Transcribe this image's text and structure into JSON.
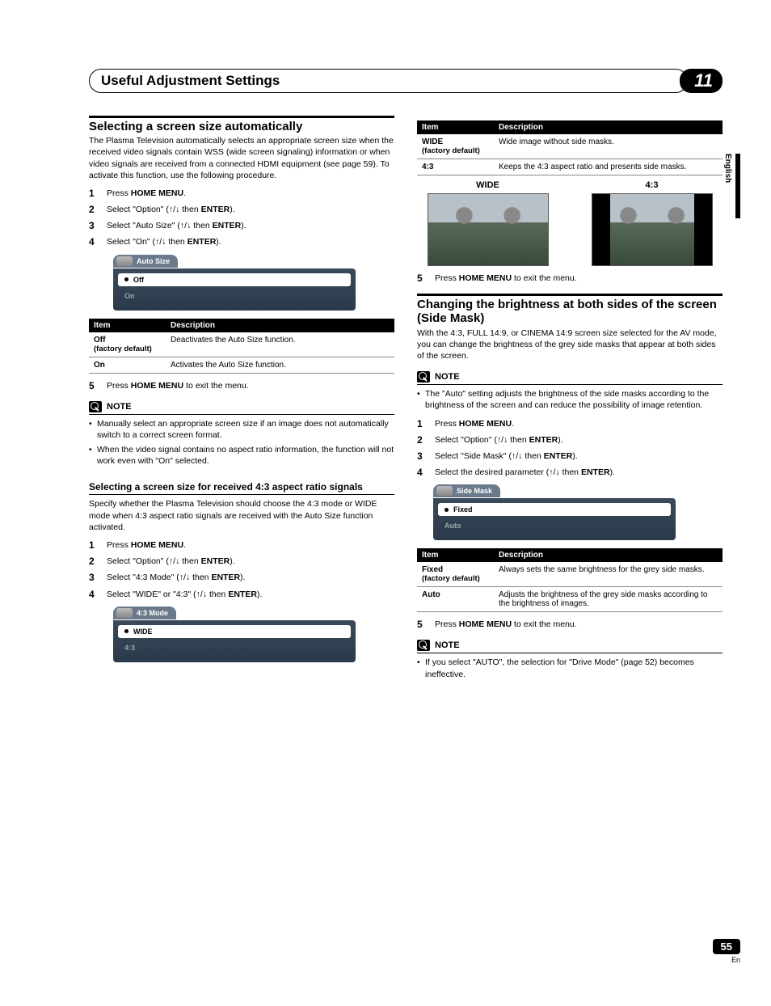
{
  "header": {
    "title": "Useful Adjustment Settings",
    "chapter": "11"
  },
  "sideTab": "English",
  "footer": {
    "page": "55",
    "lang": "En"
  },
  "left": {
    "h1": "Selecting a screen size automatically",
    "intro": "The Plasma Television automatically selects an appropriate screen size when the received video signals contain WSS (wide screen signaling) information or when video signals are received from a connected HDMI equipment (see page 59). To activate this function, use the following procedure.",
    "stepsA": {
      "s1a": "Press ",
      "s1b": "HOME MENU",
      "s1c": ".",
      "s2a": "Select \"Option\" (",
      "s2b": " then ",
      "s2c": "ENTER",
      "s2d": ").",
      "s3a": "Select \"Auto Size\" (",
      "s3b": " then ",
      "s3c": "ENTER",
      "s3d": ").",
      "s4a": "Select \"On\" (",
      "s4b": " then ",
      "s4c": "ENTER",
      "s4d": ")."
    },
    "menuA": {
      "tab": "Auto Size",
      "opt1": "Off",
      "opt2": "On"
    },
    "tableA": {
      "hItem": "Item",
      "hDesc": "Description",
      "r1a": "Off",
      "r1fd": "(factory default)",
      "r1b": "Deactivates the Auto Size function.",
      "r2a": "On",
      "r2b": "Activates the Auto Size function."
    },
    "s5a": "Press ",
    "s5b": "HOME MENU",
    "s5c": " to exit the menu.",
    "noteLabel": "NOTE",
    "noteA1": "Manually select an appropriate screen size if an image does not automatically switch to a correct screen format.",
    "noteA2": "When the video signal contains no aspect ratio information, the function will not work even with \"On\" selected.",
    "h2": "Selecting a screen size for received 4:3 aspect ratio signals",
    "intro2": "Specify whether the Plasma Television should choose the 4:3 mode or WIDE mode when 4:3 aspect ratio signals are received with the Auto Size function activated.",
    "stepsB": {
      "s1a": "Press ",
      "s1b": "HOME MENU",
      "s1c": ".",
      "s2a": "Select \"Option\" (",
      "s2b": " then ",
      "s2c": "ENTER",
      "s2d": ").",
      "s3a": "Select \"4:3 Mode\" (",
      "s3b": " then ",
      "s3c": "ENTER",
      "s3d": ").",
      "s4a": "Select \"WIDE\" or \"4:3\" (",
      "s4b": " then ",
      "s4c": "ENTER",
      "s4d": ")."
    },
    "menuB": {
      "tab": "4:3 Mode",
      "opt1": "WIDE",
      "opt2": "4:3"
    }
  },
  "right": {
    "tableB": {
      "hItem": "Item",
      "hDesc": "Description",
      "r1a": "WIDE",
      "r1fd": "(factory default)",
      "r1b": "Wide image without side masks.",
      "r2a": "4:3",
      "r2b": "Keeps the 4:3 aspect ratio and presents side masks."
    },
    "imgLabelA": "WIDE",
    "imgLabelB": "4:3",
    "s5a": "Press ",
    "s5b": "HOME MENU",
    "s5c": " to exit the menu.",
    "h1": "Changing the brightness at both sides of the screen (Side Mask)",
    "intro": "With the 4:3, FULL 14:9, or CINEMA 14:9 screen size selected for the AV mode, you can change the brightness of the grey side masks that appear at both sides of the screen.",
    "noteLabel": "NOTE",
    "noteA1": "The \"Auto\" setting adjusts the brightness of the side masks according to the brightness of the screen and can reduce the possibility of image retention.",
    "steps": {
      "s1a": "Press ",
      "s1b": "HOME MENU",
      "s1c": ".",
      "s2a": "Select \"Option\" (",
      "s2b": " then ",
      "s2c": "ENTER",
      "s2d": ").",
      "s3a": "Select \"Side Mask\" (",
      "s3b": " then ",
      "s3c": "ENTER",
      "s3d": ").",
      "s4a": "Select the desired parameter (",
      "s4b": " then ",
      "s4c": "ENTER",
      "s4d": ")."
    },
    "menuC": {
      "tab": "Side Mask",
      "opt1": "Fixed",
      "opt2": "Auto"
    },
    "tableC": {
      "hItem": "Item",
      "hDesc": "Description",
      "r1a": "Fixed",
      "r1fd": "(factory default)",
      "r1b": "Always sets the same brightness for the grey side masks.",
      "r2a": "Auto",
      "r2b": "Adjusts the brightness of the grey side masks according to the brightness of images."
    },
    "s6a": "Press ",
    "s6b": "HOME MENU",
    "s6c": " to exit the menu.",
    "noteB1": "If you select \"AUTO\", the selection for \"Drive Mode\" (page 52) becomes ineffective."
  },
  "arrows": "↑/↓",
  "nums": {
    "n1": "1",
    "n2": "2",
    "n3": "3",
    "n4": "4",
    "n5": "5"
  }
}
